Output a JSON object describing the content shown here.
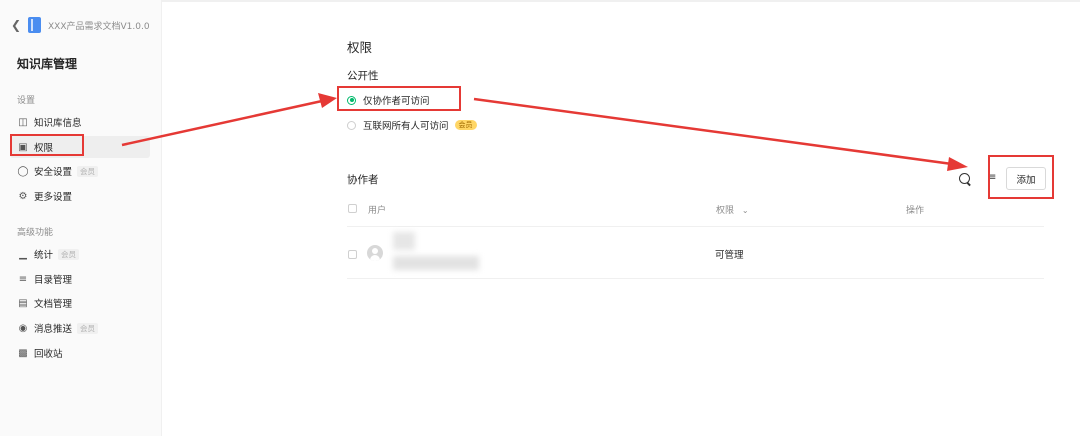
{
  "sidebar": {
    "back_icon": "chevron-left-icon",
    "doc_icon": "book-icon",
    "doc_title": "XXX产品需求文档V1.0.0",
    "kb_title": "知识库管理",
    "settings_label": "设置",
    "advanced_label": "高级功能",
    "items": {
      "kb_info": {
        "label": "知识库信息",
        "icon": "book-open-icon"
      },
      "permissions": {
        "label": "权限",
        "icon": "lock-icon"
      },
      "security": {
        "label": "安全设置",
        "icon": "shield-icon",
        "badge": "会员"
      },
      "more": {
        "label": "更多设置",
        "icon": "gear-icon"
      },
      "stats": {
        "label": "统计",
        "icon": "bar-chart-icon",
        "badge": "会员"
      },
      "toc": {
        "label": "目录管理",
        "icon": "list-icon"
      },
      "docs": {
        "label": "文档管理",
        "icon": "document-icon"
      },
      "push": {
        "label": "消息推送",
        "icon": "message-icon",
        "badge": "会员"
      },
      "trash": {
        "label": "回收站",
        "icon": "trash-icon"
      }
    }
  },
  "main": {
    "title": "权限",
    "visibility": {
      "label": "公开性",
      "options": [
        {
          "label": "仅协作者可访问",
          "checked": true
        },
        {
          "label": "互联网所有人可访问",
          "badge": "会员",
          "checked": false
        }
      ]
    },
    "collaborators": {
      "title": "协作者",
      "add_button": "添加",
      "search_icon": "search-icon",
      "filter_icon": "filter-icon",
      "columns": {
        "user": "用户",
        "permission": "权限",
        "actions": "操作"
      },
      "rows": [
        {
          "user_avatar": "avatar-icon",
          "permission": "可管理"
        }
      ]
    }
  },
  "colors": {
    "accent": "#00b96b",
    "annotation": "#e53935",
    "vip_badge": "#ffd666"
  }
}
